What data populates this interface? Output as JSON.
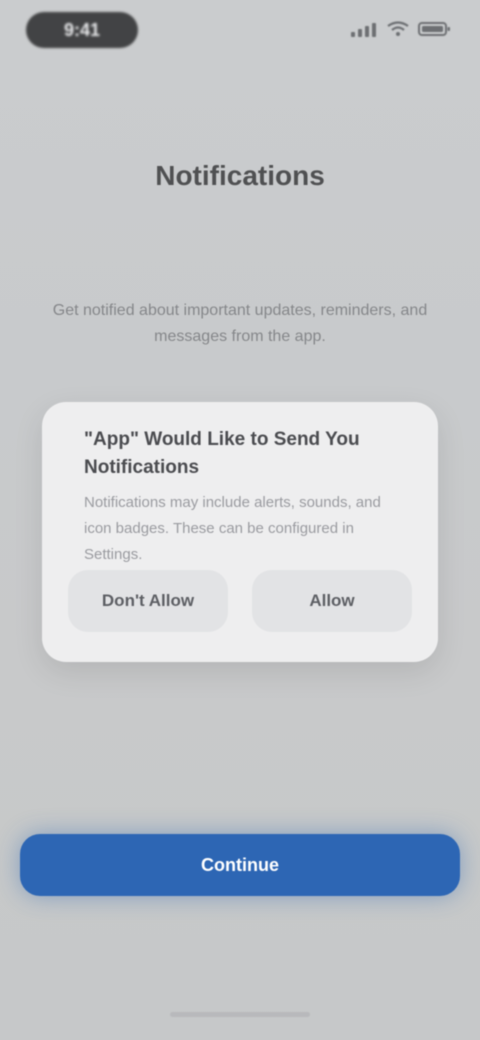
{
  "status_bar": {
    "time": "9:41"
  },
  "page": {
    "title": "Notifications",
    "description": "Get notified about important updates, reminders, and messages from the app."
  },
  "dialog": {
    "title": "\"App\" Would Like to Send You Notifications",
    "message": "Notifications may include alerts, sounds, and icon badges. These can be configured in Settings.",
    "buttons": {
      "deny": "Don't Allow",
      "allow": "Allow"
    }
  },
  "actions": {
    "continue": "Continue"
  },
  "icons": {
    "signal": "signal-icon",
    "wifi": "wifi-icon",
    "battery": "battery-icon"
  },
  "colors": {
    "background": "#cfd0d2",
    "primary": "#2d66b4",
    "dialog": "#eeeeef"
  }
}
